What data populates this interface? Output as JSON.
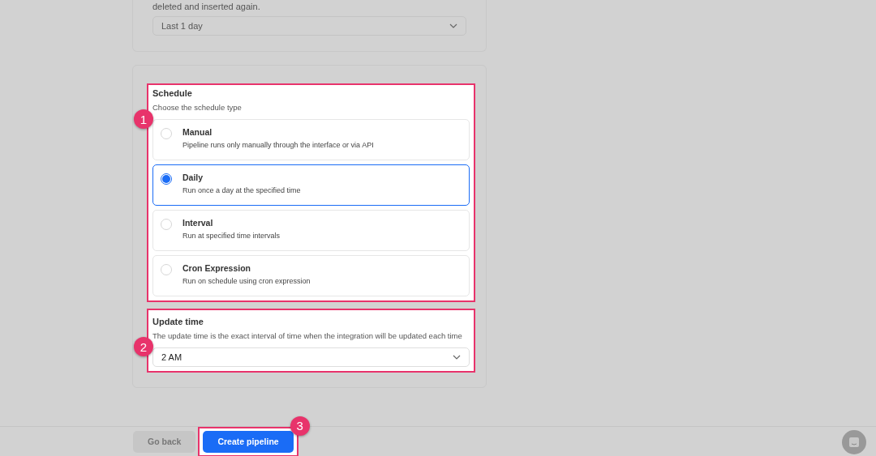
{
  "retention": {
    "note": "deleted and inserted again.",
    "select": "Last 1 day"
  },
  "schedule": {
    "title": "Schedule",
    "subtitle": "Choose the schedule type",
    "callout": "1",
    "options": [
      {
        "label": "Manual",
        "description": "Pipeline runs only manually through the interface or via API",
        "selected": false
      },
      {
        "label": "Daily",
        "description": "Run once a day at the specified time",
        "selected": true
      },
      {
        "label": "Interval",
        "description": "Run at specified time intervals",
        "selected": false
      },
      {
        "label": "Cron Expression",
        "description": "Run on schedule using cron expression",
        "selected": false
      }
    ]
  },
  "update_time": {
    "title": "Update time",
    "description": "The update time is the exact interval of time when the integration will be updated each time",
    "select": "2 AM",
    "callout": "2"
  },
  "footer": {
    "callout": "3",
    "buttons": [
      {
        "label": "Go back",
        "kind": "secondary"
      },
      {
        "label": "Create pipeline",
        "kind": "primary"
      }
    ]
  }
}
